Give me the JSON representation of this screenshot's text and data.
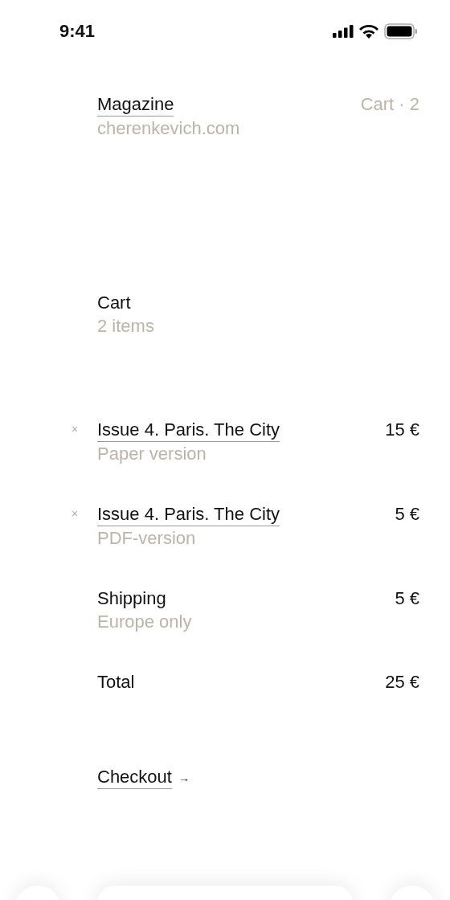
{
  "status_bar": {
    "time": "9:41"
  },
  "header": {
    "title": "Magazine",
    "subtitle": "cherenkevich.com",
    "cart_link": "Cart · 2"
  },
  "cart": {
    "title": "Cart",
    "subtitle": "2 items"
  },
  "items": [
    {
      "remove": "×",
      "name": "Issue 4. Paris. The City",
      "variant": "Paper version",
      "price": "15 €"
    },
    {
      "remove": "×",
      "name": "Issue 4. Paris. The City",
      "variant": "PDF-version",
      "price": "5 €"
    }
  ],
  "shipping": {
    "label": "Shipping",
    "note": "Europe only",
    "price": "5 €"
  },
  "total": {
    "label": "Total",
    "amount": "25 €"
  },
  "checkout": {
    "label": "Checkout",
    "arrow": "→"
  }
}
